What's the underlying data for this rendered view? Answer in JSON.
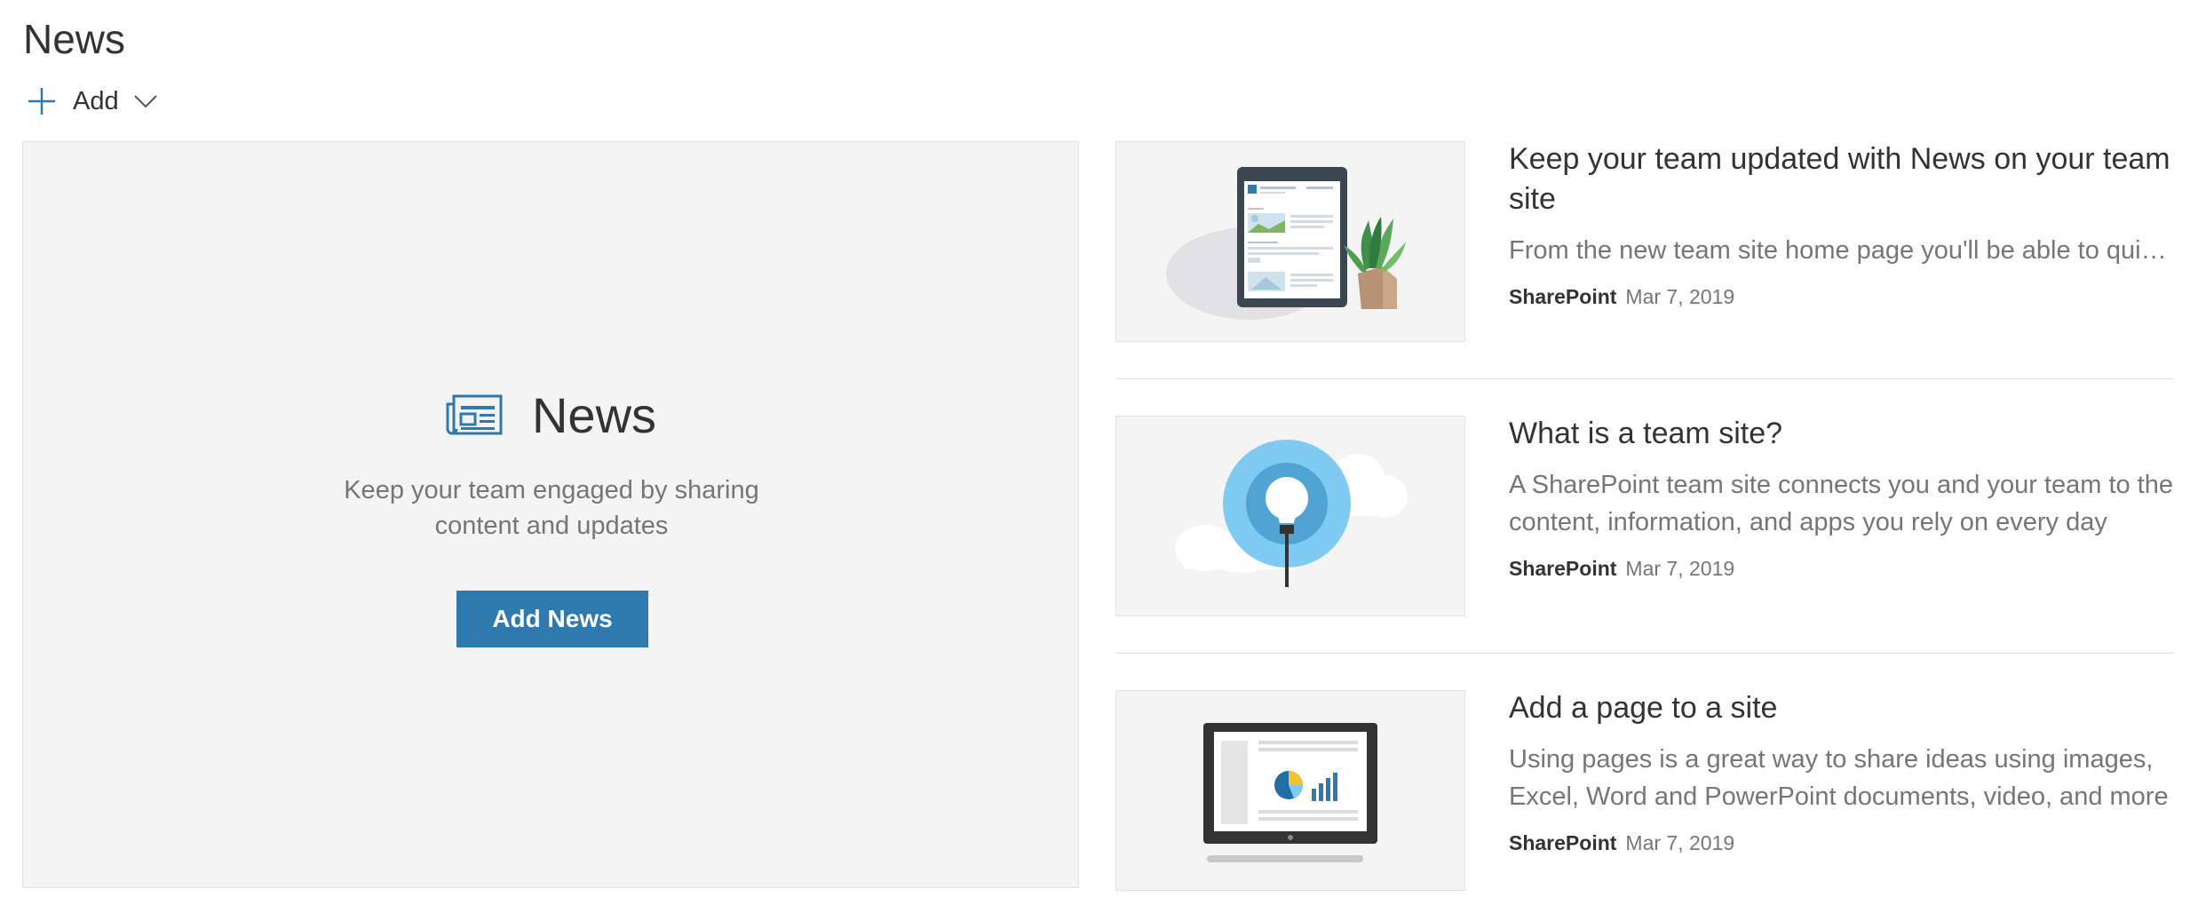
{
  "header": {
    "title": "News",
    "add_label": "Add"
  },
  "placeholder": {
    "title": "News",
    "description": "Keep your team engaged by sharing content and updates",
    "button_label": "Add News"
  },
  "items": [
    {
      "title": "Keep your team updated with News on your team site",
      "description": "From the new team site home page you'll be able to quickly share news and updates with your team",
      "author": "SharePoint",
      "date": "Mar 7, 2019",
      "thumbnail_icon": "tablet-with-plant-illustration"
    },
    {
      "title": "What is a team site?",
      "description": "A SharePoint team site connects you and your team to the content, information, and apps you rely on every day",
      "author": "SharePoint",
      "date": "Mar 7, 2019",
      "thumbnail_icon": "lightbulb-cloud-illustration"
    },
    {
      "title": "Add a page to a site",
      "description": "Using pages is a great way to share ideas using images, Excel, Word and PowerPoint documents, video, and more",
      "author": "SharePoint",
      "date": "Mar 7, 2019",
      "thumbnail_icon": "laptop-chart-illustration"
    }
  ],
  "colors": {
    "accent": "#2e79ad",
    "panel_bg": "#f4f4f4",
    "muted_text": "#767676"
  }
}
